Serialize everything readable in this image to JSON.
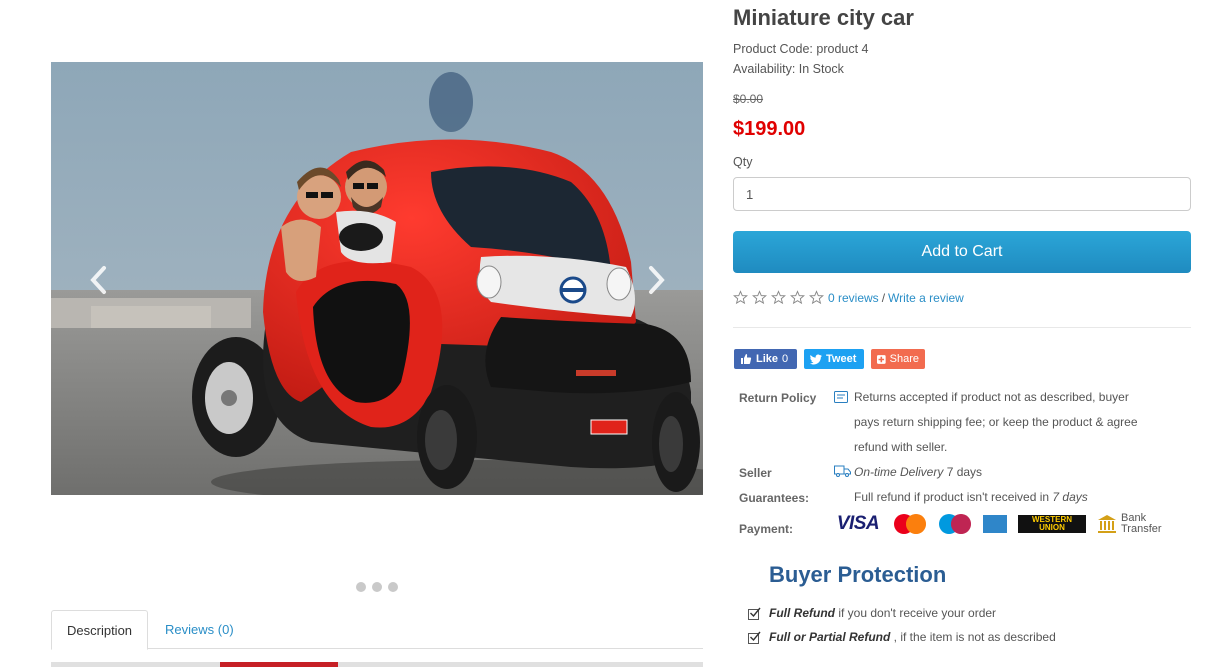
{
  "product": {
    "title": "Miniature city car",
    "code": "Product Code: product 4",
    "availability": "Availability: In Stock",
    "old_price": "$0.00",
    "price": "$199.00",
    "qty_label": "Qty",
    "qty_value": "1",
    "add_to_cart": "Add to Cart"
  },
  "rating": {
    "stars": 0,
    "max": 5,
    "reviews_link": "0 reviews",
    "separator": "/",
    "write_link": "Write a review"
  },
  "share": {
    "like": "Like",
    "like_count": "0",
    "tweet": "Tweet",
    "share": "Share"
  },
  "policy": {
    "return_label": "Return Policy",
    "return_line1": "Returns accepted if product not as described, buyer",
    "return_line2": "pays return shipping fee; or keep the product & agree",
    "return_line3": "refund with seller.",
    "seller_label": "Seller",
    "delivery_italic": "On-time Delivery",
    "delivery_days": " 7 days",
    "guarantees_label": "Guarantees:",
    "guarantee_text": "Full refund if product isn't received in ",
    "guarantee_days": "7 days",
    "payment_label": "Payment:",
    "visa": "VISA",
    "mastercard": "MasterCard",
    "maestro": "Maestro",
    "amex": "AMERICAN EXPRESS",
    "western1": "WESTERN",
    "western2": "UNION",
    "bank1": "Bank",
    "bank2": "Transfer"
  },
  "buyer_protection": {
    "title": "Buyer Protection",
    "item1_bold": "Full Refund",
    "item1_rest": " if you don't receive your order",
    "item2_bold": "Full or Partial Refund",
    "item2_rest": " , if the item is not as described"
  },
  "tabs": [
    "Description",
    "Reviews (0)"
  ],
  "colors": {
    "price": "#e00000",
    "button": "#2399cd",
    "link": "#2a8ec7",
    "facebook": "#4267b2",
    "twitter": "#1da1f2",
    "share": "#f26b4f",
    "protection_title": "#2b5d93"
  },
  "carousel": {
    "slides": 3,
    "active": 1
  }
}
